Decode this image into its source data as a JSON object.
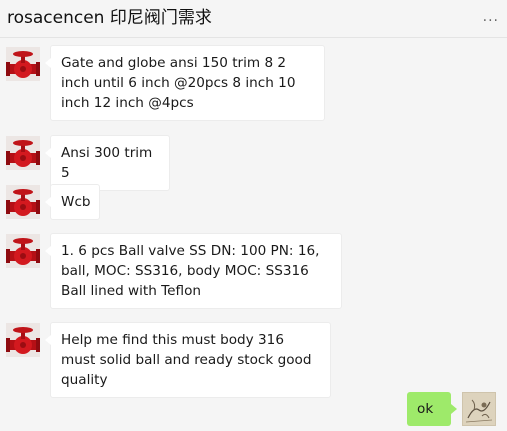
{
  "header": {
    "title": "rosacencen 印尼阀门需求",
    "more_label": "..."
  },
  "messages": [
    {
      "direction": "in",
      "text": "Gate and globe ansi 150 trim 8 2 inch until 6 inch @20pcs 8 inch 10 inch 12 inch @4pcs"
    },
    {
      "direction": "in",
      "text": "Ansi 300 trim 5"
    },
    {
      "direction": "in",
      "text": "Wcb"
    },
    {
      "direction": "in",
      "text": "1. 6 pcs Ball valve SS DN: 100 PN: 16, ball, MOC: SS316, body MOC: SS316 Ball lined with Teflon"
    },
    {
      "direction": "in",
      "text": "Help me find this must body 316 must solid ball and ready stock good quality"
    },
    {
      "direction": "out",
      "text": "ok"
    }
  ],
  "colors": {
    "background": "#f5f5f5",
    "incoming_bubble": "#ffffff",
    "outgoing_bubble": "#9eea6a",
    "avatar_red": "#c8141a"
  },
  "icons": {
    "contact_avatar": "red-valve-avatar",
    "self_avatar": "sketch-avatar"
  }
}
